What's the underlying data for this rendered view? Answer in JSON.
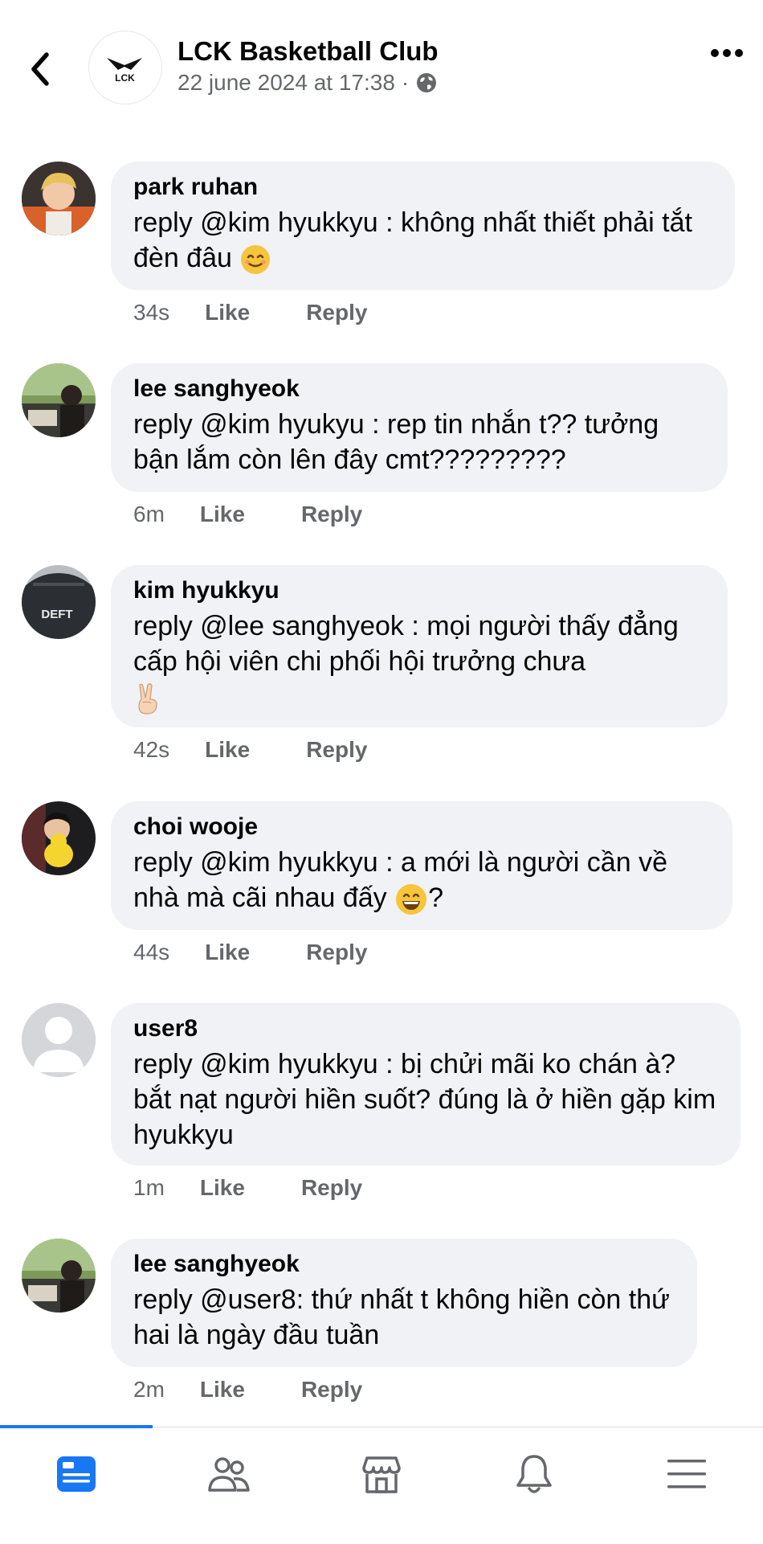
{
  "header": {
    "page_name": "LCK Basketball Club",
    "post_date": "22 june 2024 at 17:38",
    "separator": "·",
    "logo_text": "LCK"
  },
  "comments": [
    {
      "author": "park ruhan",
      "text": "reply @kim hyukkyu : không nhất thiết phải tắt đèn đâu",
      "emoji": "smiling-face-emoji",
      "time": "34s",
      "like": "Like",
      "reply": "Reply"
    },
    {
      "author": "lee sanghyeok",
      "text": "reply @kim hyukyu : rep tin nhắn t?? tưởng bận lắm còn lên đây cmt?????????",
      "time": "6m",
      "like": "Like",
      "reply": "Reply"
    },
    {
      "author": "kim hyukkyu",
      "text": "reply @lee sanghyeok : mọi người thấy đẳng cấp hội viên chi phối hội trưởng chưa",
      "emoji": "victory-hand-emoji",
      "avatar_text": "DEFT",
      "time": "42s",
      "like": "Like",
      "reply": "Reply"
    },
    {
      "author": "choi wooje",
      "text": "reply @kim hyukkyu : a mới là người cần về nhà mà cãi nhau đấy",
      "text_after": "?",
      "emoji": "grinning-face-emoji",
      "time": "44s",
      "like": "Like",
      "reply": "Reply"
    },
    {
      "author": "user8",
      "text": "reply @kim hyukkyu : bị chửi mãi ko chán à? bắt nạt người hiền suốt? đúng là ở hiền gặp kim hyukkyu",
      "time": "1m",
      "like": "Like",
      "reply": "Reply"
    },
    {
      "author": "lee sanghyeok",
      "text": "reply @user8: thứ nhất t không hiền còn thứ hai là ngày đầu tuần",
      "time": "2m",
      "like": "Like",
      "reply": "Reply"
    }
  ],
  "tabbar": {
    "active_tab": "feed",
    "accent": "#1877f2",
    "icons": [
      "feed-icon",
      "friends-icon",
      "marketplace-icon",
      "notifications-icon",
      "menu-icon"
    ]
  },
  "colors": {
    "bubble": "#f0f2f5",
    "secondary_text": "#65676b",
    "primary_text": "#050505"
  }
}
